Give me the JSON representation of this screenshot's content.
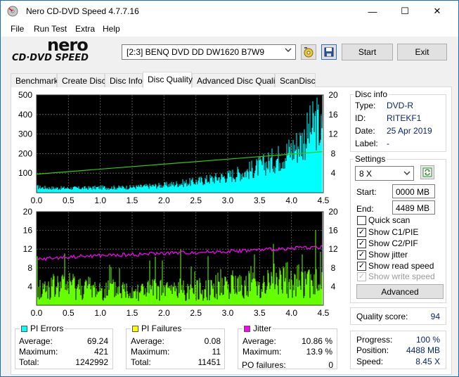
{
  "window": {
    "title": "Nero CD-DVD Speed 4.7.7.16",
    "minimize_glyph": "—",
    "maximize_glyph": "☐",
    "close_glyph": "✕"
  },
  "menu": [
    "File",
    "Run Test",
    "Extra",
    "Help"
  ],
  "logo": {
    "line1": "nero",
    "line2": "CD·DVD SPEED"
  },
  "toolbar": {
    "drive": "[2:3]   BENQ DVD DD DW1620 B7W9",
    "start_label": "Start",
    "exit_label": "Exit"
  },
  "tabs": [
    "Benchmark",
    "Create Disc",
    "Disc Info",
    "Disc Quality",
    "Advanced Disc Quality",
    "ScanDisc"
  ],
  "active_tab": "Disc Quality",
  "chart_data": [
    {
      "type": "area",
      "title": "",
      "x_ticks": [
        "0.0",
        "0.5",
        "1.0",
        "1.5",
        "2.0",
        "2.5",
        "3.0",
        "3.5",
        "4.0",
        "4.5"
      ],
      "y_left_ticks": [
        "500",
        "400",
        "300",
        "200",
        "100"
      ],
      "y_right_ticks": [
        "20",
        "16",
        "12",
        "8",
        "4"
      ],
      "xlim": [
        0,
        4.5
      ],
      "ylim_left": [
        0,
        500
      ],
      "ylim_right": [
        0,
        20
      ],
      "series": [
        {
          "name": "PI Errors",
          "color": "#00ffff",
          "x": [
            0.0,
            0.25,
            0.5,
            0.75,
            1.0,
            1.25,
            1.5,
            1.75,
            2.0,
            2.25,
            2.5,
            2.75,
            3.0,
            3.25,
            3.5,
            3.75,
            4.0,
            4.1,
            4.2,
            4.3,
            4.4,
            4.49
          ],
          "y": [
            30,
            25,
            25,
            25,
            28,
            28,
            30,
            35,
            40,
            50,
            60,
            75,
            90,
            110,
            140,
            180,
            230,
            260,
            290,
            340,
            380,
            300
          ]
        },
        {
          "name": "Read Speed",
          "color": "#33cc00",
          "axis": "right",
          "x": [
            0.0,
            4.49
          ],
          "y": [
            3.8,
            8.4
          ]
        }
      ],
      "grid": true
    },
    {
      "type": "bar",
      "title": "",
      "x_ticks": [
        "0.0",
        "0.5",
        "1.0",
        "1.5",
        "2.0",
        "2.5",
        "3.0",
        "3.5",
        "4.0",
        "4.5"
      ],
      "y_left_ticks": [
        "20",
        "16",
        "12",
        "8",
        "4"
      ],
      "y_right_ticks": [
        "20",
        "16",
        "12",
        "8",
        "4"
      ],
      "xlim": [
        0,
        4.5
      ],
      "ylim_left": [
        0,
        20
      ],
      "ylim_right": [
        0,
        20
      ],
      "series": [
        {
          "name": "PI Failures",
          "color": "#66ff00",
          "x": [
            0.0,
            0.5,
            1.0,
            1.5,
            2.0,
            2.5,
            3.0,
            3.5,
            4.0,
            4.49
          ],
          "y": [
            3,
            4,
            3,
            3,
            3,
            3,
            4,
            4,
            5,
            4
          ]
        },
        {
          "name": "Jitter",
          "color": "#ff00ff",
          "axis": "right",
          "x": [
            0.0,
            0.5,
            1.0,
            1.5,
            2.0,
            2.5,
            3.0,
            3.5,
            4.0,
            4.49
          ],
          "y": [
            9.8,
            10.3,
            10.6,
            10.8,
            11.1,
            11.3,
            11.5,
            11.8,
            12.2,
            12.5
          ]
        }
      ],
      "grid": true
    }
  ],
  "pi_errors": {
    "title": "PI Errors",
    "color": "#00ffff",
    "average_label": "Average:",
    "average": "69.24",
    "maximum_label": "Maximum:",
    "maximum": "421",
    "total_label": "Total:",
    "total": "1242992"
  },
  "pi_failures": {
    "title": "PI Failures",
    "color": "#ffff00",
    "average_label": "Average:",
    "average": "0.08",
    "maximum_label": "Maximum:",
    "maximum": "11",
    "total_label": "Total:",
    "total": "11451"
  },
  "jitter": {
    "title": "Jitter",
    "color": "#ff00ff",
    "average_label": "Average:",
    "average": "10.86 %",
    "maximum_label": "Maximum:",
    "maximum": "13.9 %",
    "po_label": "PO failures:",
    "po": "0"
  },
  "disc_info": {
    "title": "Disc info",
    "type_label": "Type:",
    "type": "DVD-R",
    "id_label": "ID:",
    "id": "RITEKF1",
    "date_label": "Date:",
    "date": "25 Apr 2019",
    "label_label": "Label:",
    "label": "-"
  },
  "settings": {
    "title": "Settings",
    "speed": "8 X",
    "start_label": "Start:",
    "start": "0000 MB",
    "end_label": "End:",
    "end": "4489 MB",
    "quick_scan": "Quick scan",
    "show_c1": "Show C1/PIE",
    "show_c2": "Show C2/PIF",
    "show_jitter": "Show jitter",
    "show_read": "Show read speed",
    "show_write": "Show write speed",
    "advanced_label": "Advanced",
    "check": "✓"
  },
  "quality": {
    "label": "Quality score:",
    "value": "94"
  },
  "progress": {
    "progress_label": "Progress:",
    "progress": "100 %",
    "position_label": "Position:",
    "position": "4488 MB",
    "speed_label": "Speed:",
    "speed": "8.45 X"
  }
}
